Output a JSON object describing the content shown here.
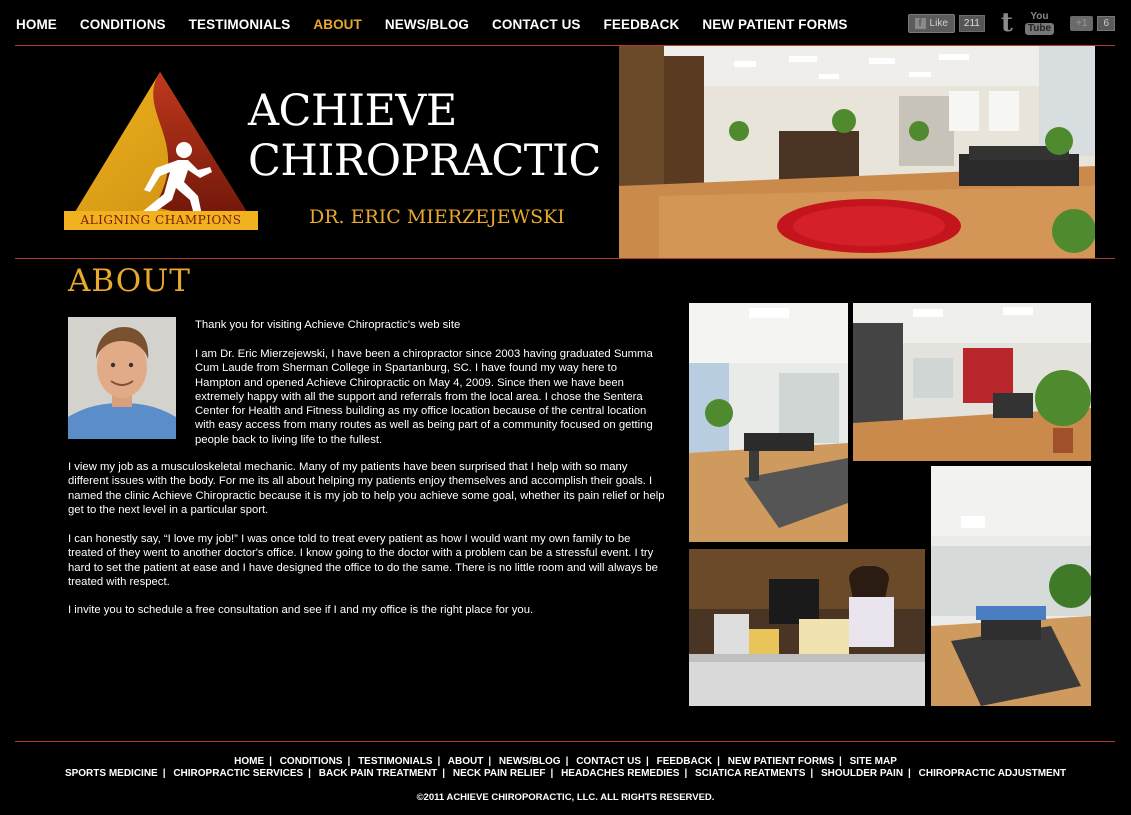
{
  "nav": {
    "items": [
      {
        "label": "HOME",
        "active": false
      },
      {
        "label": "CONDITIONS",
        "active": false
      },
      {
        "label": "TESTIMONIALS",
        "active": false
      },
      {
        "label": "ABOUT",
        "active": true
      },
      {
        "label": "NEWS/BLOG",
        "active": false
      },
      {
        "label": "CONTACT US",
        "active": false
      },
      {
        "label": "FEEDBACK",
        "active": false
      },
      {
        "label": "NEW PATIENT FORMS",
        "active": false
      }
    ],
    "active_color": "#e8a92d"
  },
  "social": {
    "facebook_label": "Like",
    "facebook_count": "211",
    "twitter_glyph": "t",
    "youtube_top": "You",
    "youtube_bottom": "Tube",
    "gplus_label": "+1",
    "gplus_count": "6"
  },
  "header": {
    "brand_line1": "ACHIEVE",
    "brand_line2": "CHIROPRACTIC",
    "doctor": "DR. ERIC MIERZEJEWSKI",
    "logo_tagline": "ALIGNING CHAMPIONS"
  },
  "about": {
    "title": "ABOUT",
    "p1": "Thank you for visiting Achieve Chiropractic's web site",
    "p2": "I am Dr. Eric Mierzejewski, I have been a chiropractor since 2003 having graduated Summa Cum Laude from Sherman College in Spartanburg, SC. I have found my way here to Hampton and opened Achieve Chiropractic on May 4, 2009. Since then we have been extremely happy with all the support and referrals from the local area. I chose the Sentera Center for Health and Fitness building as my office location because of the central location with easy access from many routes as well as being part of a community focused on getting people back to living life to the fullest.",
    "p3": "I view my job as a musculoskeletal mechanic. Many of my patients have been surprised that I help with so many different issues with the body. For me its all about helping my patients enjoy themselves and accomplish their goals. I named the clinic Achieve Chiropractic because it is my job to help you achieve some goal, whether its pain relief or help get to the next level in a particular sport.",
    "p4": "I can honestly say,  “I love my job!” I was once told to treat every patient as how I would want my own family to be treated of they went to another doctor's office. I know going to the doctor with a problem can be a stressful event. I try hard to set the patient at ease and I have designed the office to do the same. There is no little room and will always be treated with respect.",
    "p5": "I invite you to schedule a free consultation and see if I and my office is the right place for you."
  },
  "footer": {
    "row1": [
      "HOME",
      "CONDITIONS",
      "TESTIMONIALS",
      "ABOUT",
      "NEWS/BLOG",
      "CONTACT US",
      "FEEDBACK",
      "NEW PATIENT FORMS",
      "SITE MAP"
    ],
    "row2": [
      "SPORTS MEDICINE",
      "CHIROPRACTIC SERVICES",
      "BACK PAIN TREATMENT",
      "NECK PAIN RELIEF",
      "HEADACHES REMEDIES",
      "SCIATICA REATMENTS",
      "SHOULDER PAIN",
      "CHIROPRACTIC ADJUSTMENT"
    ],
    "copyright": "©2011 ACHIEVE CHIROPORACTIC, LLC. ALL RIGHTS RESERVED."
  },
  "colors": {
    "accent": "#e8a92d",
    "rule": "#b43b2a",
    "background": "#000000"
  }
}
